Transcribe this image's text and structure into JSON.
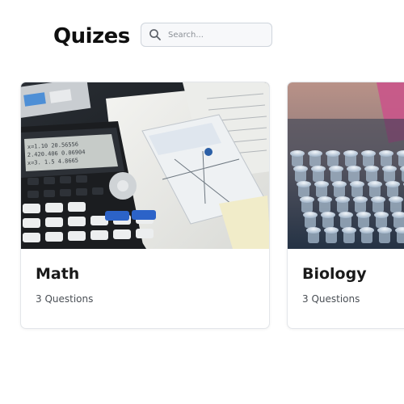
{
  "header": {
    "title": "Quizes",
    "search_placeholder": "Search..."
  },
  "icons": {
    "search": "search-icon"
  },
  "quizzes": [
    {
      "title": "Math",
      "questions": "3 Questions",
      "image": "calculator-photo"
    },
    {
      "title": "Biology",
      "questions": "3 Questions",
      "image": "test-tubes-photo"
    }
  ]
}
